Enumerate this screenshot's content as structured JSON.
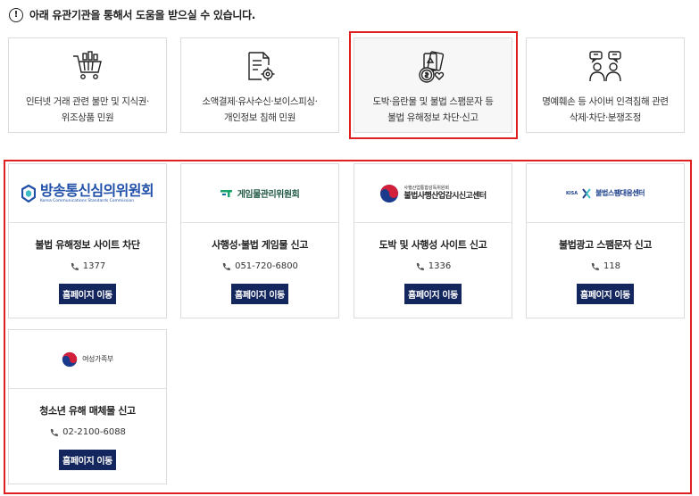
{
  "notice": {
    "icon_text": "!",
    "text": "아래 유관기관을 통해서 도움을 받으실 수 있습니다."
  },
  "categories": [
    {
      "icon": "shopping-cart-icon",
      "label_line1": "인터넷 거래 관련 불만 및 지식권·",
      "label_line2": "위조상품 민원"
    },
    {
      "icon": "document-gear-icon",
      "label_line1": "소액결제·유사수신·보이스피싱·",
      "label_line2": "개인정보 침해 민원"
    },
    {
      "icon": "gambling-cards-icon",
      "label_line1": "도박·음란물 및 불법 스팸문자 등",
      "label_line2": "불법 유해정보 차단·신고"
    },
    {
      "icon": "people-dispute-icon",
      "label_line1": "명예훼손 등 사이버 인격침해 관련",
      "label_line2": "삭제·차단·분쟁조정"
    }
  ],
  "orgs": [
    {
      "logo_text": "방송통신심의위원회",
      "logo_subtext": "Korea Communications Standards Commission",
      "name": "불법 유해정보 사이트 차단",
      "phone": "1377",
      "button": "홈페이지 이동"
    },
    {
      "logo_text": "게임물관리위원회",
      "name": "사행성·불법 게임물 신고",
      "phone": "051-720-6800",
      "button": "홈페이지 이동"
    },
    {
      "logo_text_top": "사행산업통합감독위원회",
      "logo_text": "불법사행산업감시신고센터",
      "name": "도박 및 사행성 사이트 신고",
      "phone": "1336",
      "button": "홈페이지 이동"
    },
    {
      "logo_prefix": "KISA",
      "logo_text": "불법스팸대응센터",
      "name": "불법광고 스팸문자 신고",
      "phone": "118",
      "button": "홈페이지 이동"
    },
    {
      "logo_text": "여성가족부",
      "name": "청소년 유해 매체물 신고",
      "phone": "02-2100-6088",
      "button": "홈페이지 이동"
    }
  ],
  "colors": {
    "highlight": "#e02020",
    "button_bg": "#13265d",
    "border": "#dcdcdc"
  }
}
